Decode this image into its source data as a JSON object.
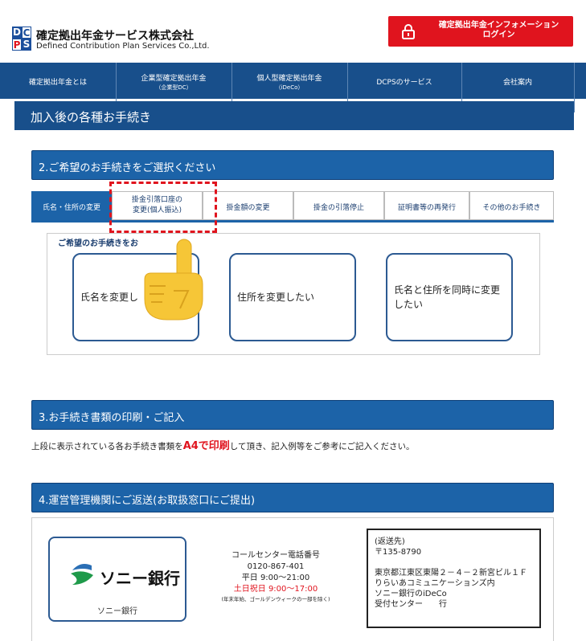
{
  "header": {
    "logo_letters": [
      "D",
      "C",
      "P",
      "S"
    ],
    "company_name": "確定拠出年金サービス株式会社",
    "company_name_en": "Defined Contribution Plan Services Co.,Ltd.",
    "login_line1": "確定拠出年金インフォメーション",
    "login_line2": "ログイン"
  },
  "nav": [
    {
      "label": "確定拠出年金とは",
      "sub": ""
    },
    {
      "label": "企業型確定拠出年金",
      "sub": "（企業型DC）"
    },
    {
      "label": "個人型確定拠出年金",
      "sub": "（iDeCo）"
    },
    {
      "label": "DCPSのサービス",
      "sub": ""
    },
    {
      "label": "会社案内",
      "sub": ""
    }
  ],
  "page_title": "加入後の各種お手続き",
  "section2": {
    "title": "2.ご希望のお手続きをご選択ください",
    "tabs": [
      {
        "line1": "氏名・住所の変更",
        "line2": ""
      },
      {
        "line1": "掛金引落口座の",
        "line2": "変更(個人振込)"
      },
      {
        "line1": "掛金額の変更",
        "line2": ""
      },
      {
        "line1": "掛金の引落停止",
        "line2": ""
      },
      {
        "line1": "証明書等の再発行",
        "line2": ""
      },
      {
        "line1": "その他のお手続き",
        "line2": ""
      }
    ],
    "options_caption": "ご希望のお手続きをお",
    "options": [
      {
        "label": "氏名を変更し"
      },
      {
        "label": "住所を変更したい"
      },
      {
        "label": "氏名と住所を同時に変更したい"
      }
    ]
  },
  "section3": {
    "title": "3.お手続き書類の印刷・ご記入",
    "note_before": "上段に表示されている各お手続き書類を",
    "note_emphasis": "A4で印刷",
    "note_after": "して頂き、記入例等をご参考にご記入ください。"
  },
  "section4": {
    "title": "4.運営管理機関にご返送(お取扱窓口にご提出)",
    "bank_logo_text": "ソニー銀行",
    "bank_name": "ソニー銀行",
    "call_title": "コールセンター電話番号",
    "call_number": "0120-867-401",
    "call_weekday": "平日 9:00～21:00",
    "call_holiday": "土日祝日 9:00～17:00",
    "call_note": "(年末年始、ゴールデンウィークの一部を除く)",
    "address_lines": [
      "(返送先)",
      "〒135-8790",
      "",
      "東京都江東区東陽２－４－２新宮ビル１Ｆ",
      "りらいあコミュニケーションズ内",
      "ソニー銀行のiDeCo",
      "受付センター　　行"
    ]
  },
  "colors": {
    "navy": "#184f8b",
    "section_blue": "#1c63a8",
    "brand_red": "#e0141e",
    "card_border": "#2c5a92"
  },
  "icons": [
    "lock-icon",
    "pointing-hand-icon",
    "sony-bank-logo"
  ]
}
